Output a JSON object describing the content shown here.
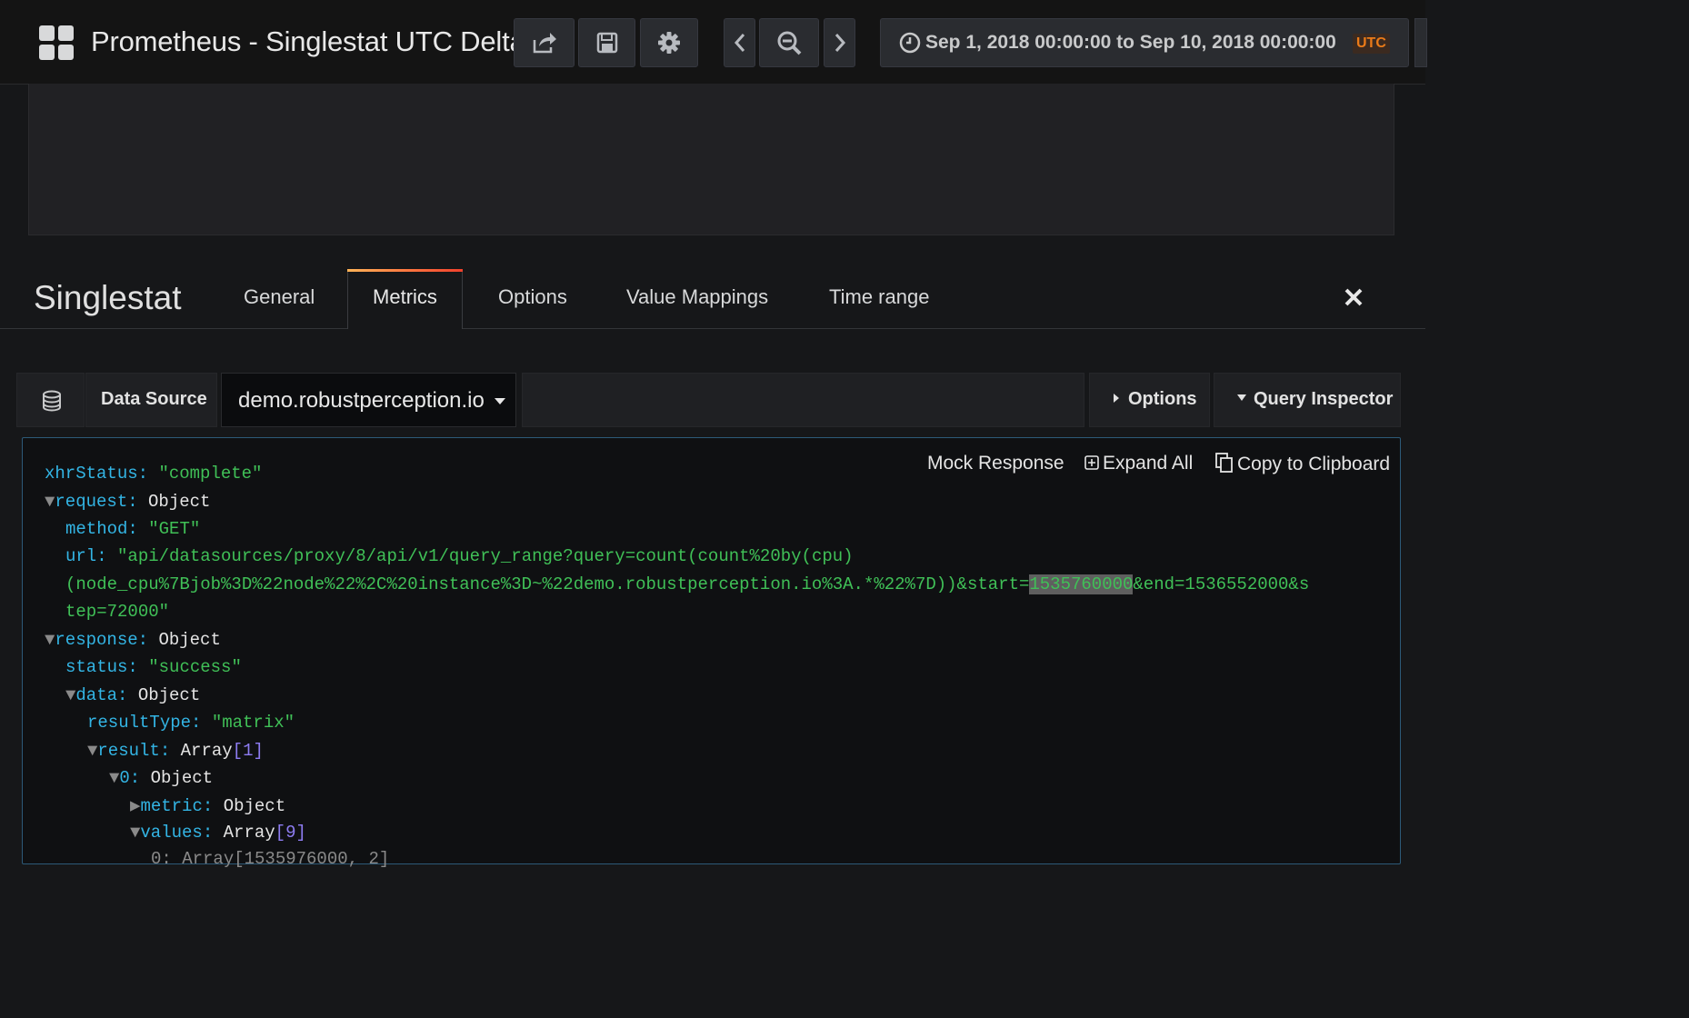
{
  "header": {
    "title": "Prometheus - Singlestat UTC Delta",
    "time_range": "Sep 1, 2018 00:00:00 to Sep 10, 2018 00:00:00",
    "timezone": "UTC",
    "accent_color": "#eb7b18"
  },
  "editor": {
    "title": "Singlestat",
    "tabs": [
      "General",
      "Metrics",
      "Options",
      "Value Mappings",
      "Time range"
    ],
    "active_tab": "Metrics"
  },
  "query": {
    "datasource_label": "Data Source",
    "datasource_value": "demo.robustperception.io",
    "options_label": "Options",
    "inspector_label": "Query Inspector"
  },
  "inspector": {
    "mock_label": "Mock Response",
    "expand_label": "Expand All",
    "copy_label": "Copy to Clipboard",
    "xhr_key": "xhrStatus:",
    "xhr_val": "\"complete\"",
    "request_key": "request:",
    "request_type": "Object",
    "method_key": "method:",
    "method_val": "\"GET\"",
    "url_key": "url:",
    "url_line1": "\"api/datasources/proxy/8/api/v1/query_range?query=count(count%20by(cpu)",
    "url_line2_a": "(node_cpu%7Bjob%3D%22node%22%2C%20instance%3D~%22demo.robustperception.io%3A.*%22%7D))&start=",
    "url_line2_hl": "1535760000",
    "url_line2_b": "&end=1536552000&s",
    "url_line3": "tep=72000\"",
    "response_key": "response:",
    "response_type": "Object",
    "status_key": "status:",
    "status_val": "\"success\"",
    "data_key": "data:",
    "data_type": "Object",
    "resulttype_key": "resultType:",
    "resulttype_val": "\"matrix\"",
    "result_key": "result:",
    "result_type": "Array",
    "result_count": "1",
    "item0_key": "0:",
    "item0_type": "Object",
    "metric_key": "metric:",
    "metric_type": "Object",
    "values_key": "values:",
    "values_type": "Array",
    "values_count": "9",
    "cut_line": "0: Array[1535976000, 2]"
  }
}
